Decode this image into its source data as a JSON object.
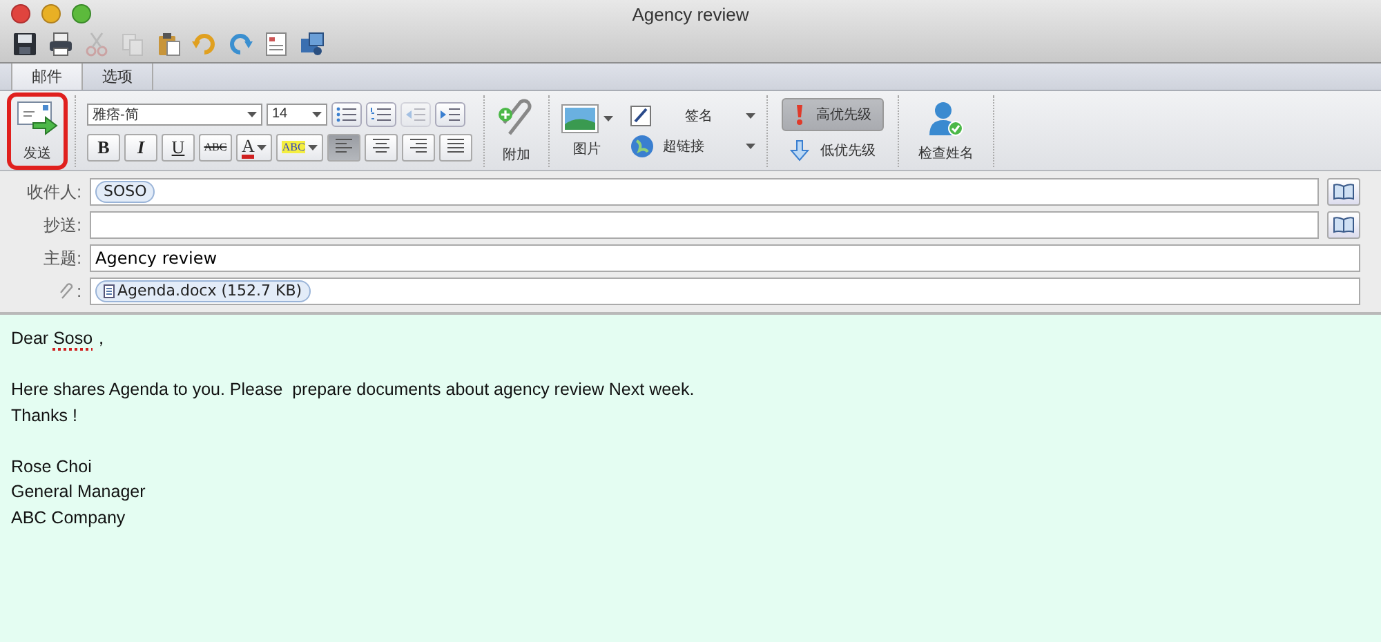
{
  "window": {
    "title": "Agency review"
  },
  "toolbar": [
    {
      "kind": "save",
      "disabled": false
    },
    {
      "kind": "print",
      "disabled": false
    },
    {
      "kind": "cut",
      "disabled": true
    },
    {
      "kind": "copy",
      "disabled": true
    },
    {
      "kind": "paste",
      "disabled": false
    },
    {
      "kind": "undo",
      "disabled": false
    },
    {
      "kind": "redo",
      "disabled": false
    },
    {
      "kind": "form",
      "disabled": false
    },
    {
      "kind": "media",
      "disabled": false
    }
  ],
  "tabs": [
    {
      "label": "邮件",
      "selected": true
    },
    {
      "label": "选项",
      "selected": false
    }
  ],
  "ribbon": {
    "send": {
      "label": "发送",
      "highlighted": true
    },
    "font": {
      "value": "雅痞-简"
    },
    "size": {
      "value": "14"
    },
    "list_buttons": [
      {
        "kind": "bullets",
        "disabled": false
      },
      {
        "kind": "numbers",
        "disabled": false
      },
      {
        "kind": "outdent",
        "disabled": true
      },
      {
        "kind": "indent",
        "disabled": false
      }
    ],
    "format_buttons": [
      {
        "kind": "bold",
        "label": "B"
      },
      {
        "kind": "italic",
        "label": "I"
      },
      {
        "kind": "underline",
        "label": "U"
      },
      {
        "kind": "strike",
        "label": "ABC"
      }
    ],
    "font_color": {
      "label": "A"
    },
    "highlight_color": {
      "label": "ABC"
    },
    "align_buttons": [
      {
        "kind": "left",
        "selected": true
      },
      {
        "kind": "center",
        "selected": false
      },
      {
        "kind": "right",
        "selected": false
      },
      {
        "kind": "justify",
        "selected": false
      }
    ],
    "attach": {
      "label": "附加"
    },
    "picture": {
      "label": "图片"
    },
    "signature": {
      "label": "签名"
    },
    "hyperlink": {
      "label": "超链接"
    },
    "priority": [
      {
        "kind": "high",
        "label": "高优先级",
        "selected": true
      },
      {
        "kind": "low",
        "label": "低优先级",
        "selected": false
      }
    ],
    "check_names": {
      "label": "检查姓名"
    }
  },
  "header": {
    "to": {
      "label": "收件人:",
      "recipients": [
        "SOSO"
      ]
    },
    "cc": {
      "label": "抄送:"
    },
    "subject": {
      "label": "主题:",
      "value": "Agency review"
    },
    "attachments": {
      "label": ":",
      "files": [
        "Agenda.docx (152.7 KB)"
      ]
    }
  },
  "body": {
    "paragraphs": [
      {
        "lines": [
          [
            {
              "text": "Dear "
            },
            {
              "text": "Soso",
              "misspelled": true
            },
            {
              "text": "，"
            }
          ]
        ]
      },
      {
        "lines": [
          [
            {
              "text": "Here shares Agenda to you. Please  prepare documents about agency review Next week."
            }
          ],
          [
            {
              "text": "Thanks !"
            }
          ]
        ]
      },
      {
        "lines": [
          [
            {
              "text": "Rose Choi"
            }
          ],
          [
            {
              "text": "General Manager"
            }
          ],
          [
            {
              "text": "ABC Company"
            }
          ]
        ]
      }
    ]
  }
}
